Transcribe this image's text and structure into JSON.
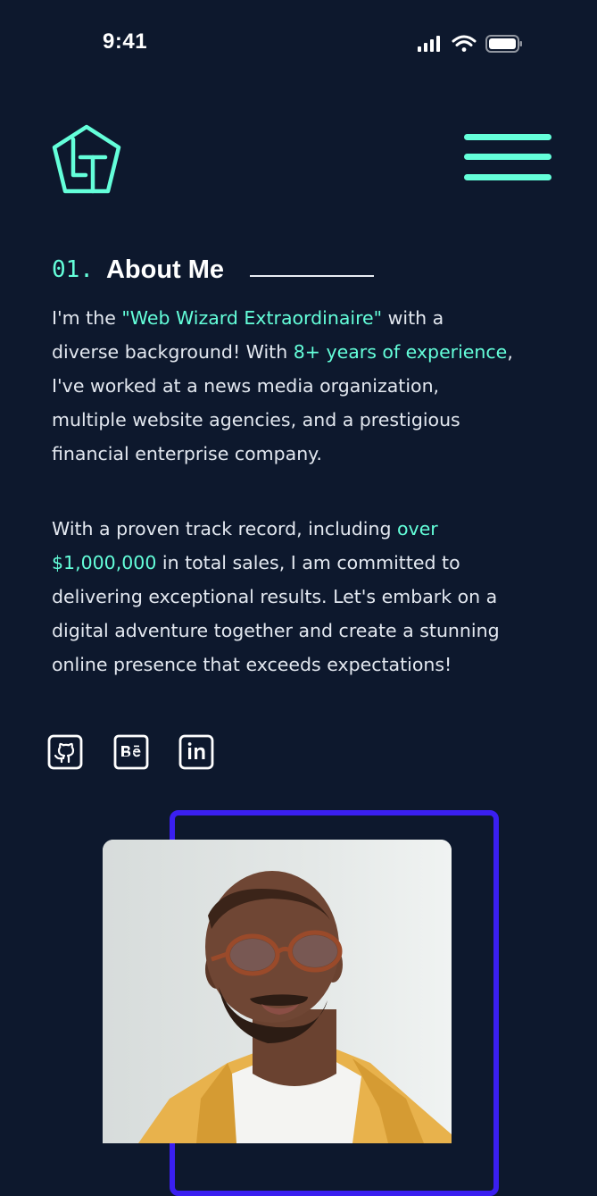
{
  "status_bar": {
    "time": "9:41",
    "icons": [
      "signal-icon",
      "wifi-icon",
      "battery-icon"
    ]
  },
  "header": {
    "logo": "LT",
    "menu_icon": "hamburger-menu-icon"
  },
  "section": {
    "number": "01.",
    "title": "About Me"
  },
  "about": {
    "p1": [
      {
        "text": "I'm the ",
        "highlight": false
      },
      {
        "text": "\"Web Wizard Extraordinaire\"",
        "highlight": true
      },
      {
        "text": " with a diverse background! With ",
        "highlight": false
      },
      {
        "text": "8+ years of experience",
        "highlight": true
      },
      {
        "text": ", I've worked at a news media organization, multiple website agencies, and a prestigious financial enterprise company.",
        "highlight": false
      }
    ],
    "p2": [
      {
        "text": "With a proven track record, including ",
        "highlight": false
      },
      {
        "text": "over $1,000,000",
        "highlight": true
      },
      {
        "text": " in total sales, I am committed to delivering exceptional results. Let's embark on a digital adventure together and create a stunning online presence that exceeds expectations!",
        "highlight": false
      }
    ]
  },
  "social": [
    {
      "name": "github-icon"
    },
    {
      "name": "behance-icon"
    },
    {
      "name": "linkedin-icon"
    }
  ],
  "colors": {
    "background": "#0d182d",
    "accent": "#64ffda",
    "frame": "#3a1ff0",
    "text": "#e3e8f0"
  }
}
